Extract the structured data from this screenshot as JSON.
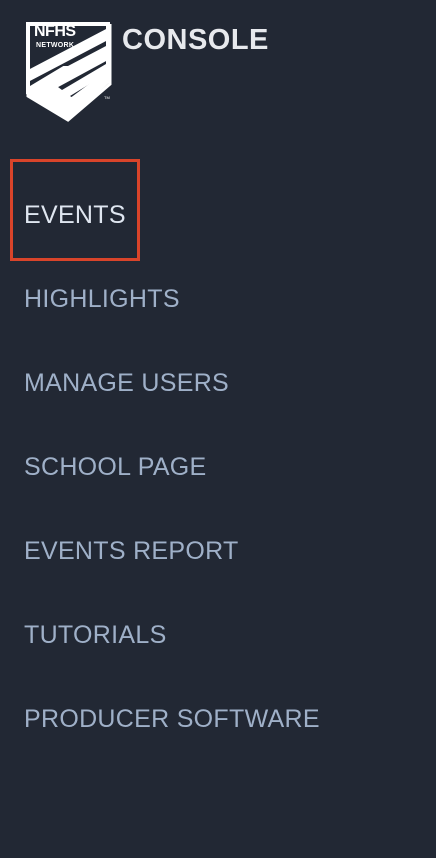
{
  "brand": {
    "logo_top": "NFHS",
    "logo_sub": "NETWORK",
    "logo_tm": "TM",
    "title": "CONSOLE"
  },
  "nav": {
    "items": [
      {
        "label": "EVENTS",
        "active": true
      },
      {
        "label": "HIGHLIGHTS",
        "active": false
      },
      {
        "label": "MANAGE USERS",
        "active": false
      },
      {
        "label": "SCHOOL PAGE",
        "active": false
      },
      {
        "label": "EVENTS REPORT",
        "active": false
      },
      {
        "label": "TUTORIALS",
        "active": false
      },
      {
        "label": "PRODUCER SOFTWARE",
        "active": false
      }
    ]
  },
  "colors": {
    "background": "#222834",
    "nav_text": "#9fb0c8",
    "highlight_border": "#d9442a"
  }
}
